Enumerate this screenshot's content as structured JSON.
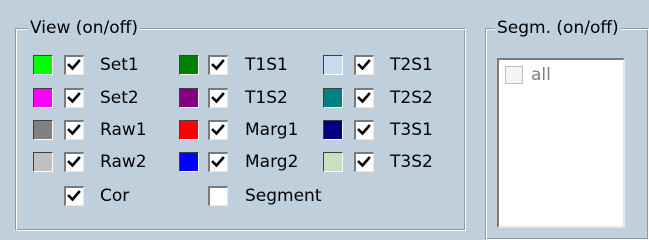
{
  "view_group": {
    "title": "View (on/off)",
    "columns": [
      [
        {
          "label": "Set1",
          "color": "#00ff00",
          "checked": true
        },
        {
          "label": "Set2",
          "color": "#ff00ff",
          "checked": true
        },
        {
          "label": "Raw1",
          "color": "#808080",
          "checked": true
        },
        {
          "label": "Raw2",
          "color": "#c0c0c0",
          "checked": true
        },
        {
          "label": "Cor",
          "color": null,
          "checked": true
        }
      ],
      [
        {
          "label": "T1S1",
          "color": "#008000",
          "checked": true
        },
        {
          "label": "T1S2",
          "color": "#800080",
          "checked": true
        },
        {
          "label": "Marg1",
          "color": "#ff0000",
          "checked": true
        },
        {
          "label": "Marg2",
          "color": "#0000ff",
          "checked": true
        },
        {
          "label": "Segment",
          "color": null,
          "checked": false
        }
      ],
      [
        {
          "label": "T2S1",
          "color": "#c6dcf2",
          "checked": true
        },
        {
          "label": "T2S2",
          "color": "#008080",
          "checked": true
        },
        {
          "label": "T3S1",
          "color": "#000080",
          "checked": true
        },
        {
          "label": "T3S2",
          "color": "#c8e0c0",
          "checked": true
        }
      ]
    ]
  },
  "segm_group": {
    "title": "Segm. (on/off)",
    "items": [
      {
        "label": "all",
        "checked": false,
        "disabled": true
      }
    ]
  }
}
